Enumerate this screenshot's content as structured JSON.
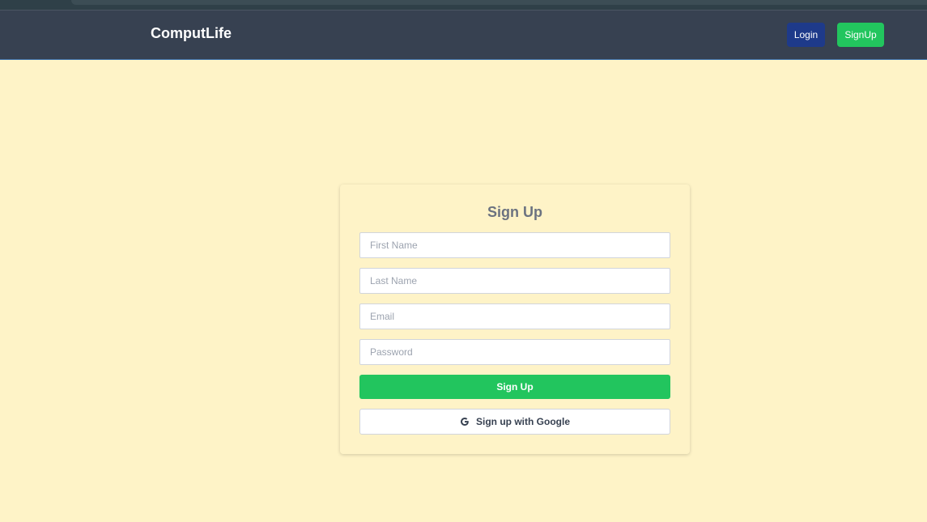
{
  "navbar": {
    "brand": "ComputLife",
    "login_label": "Login",
    "signup_label": "SignUp"
  },
  "form": {
    "title": "Sign Up",
    "first_name_placeholder": "First Name",
    "last_name_placeholder": "Last Name",
    "email_placeholder": "Email",
    "password_placeholder": "Password",
    "submit_label": "Sign Up",
    "google_label": "Sign up with Google",
    "google_icon": "google-icon"
  },
  "colors": {
    "page_bg": "#fef3c7",
    "navbar_bg": "#374151",
    "login_btn": "#1e3a8a",
    "accent_green": "#22c55e"
  }
}
